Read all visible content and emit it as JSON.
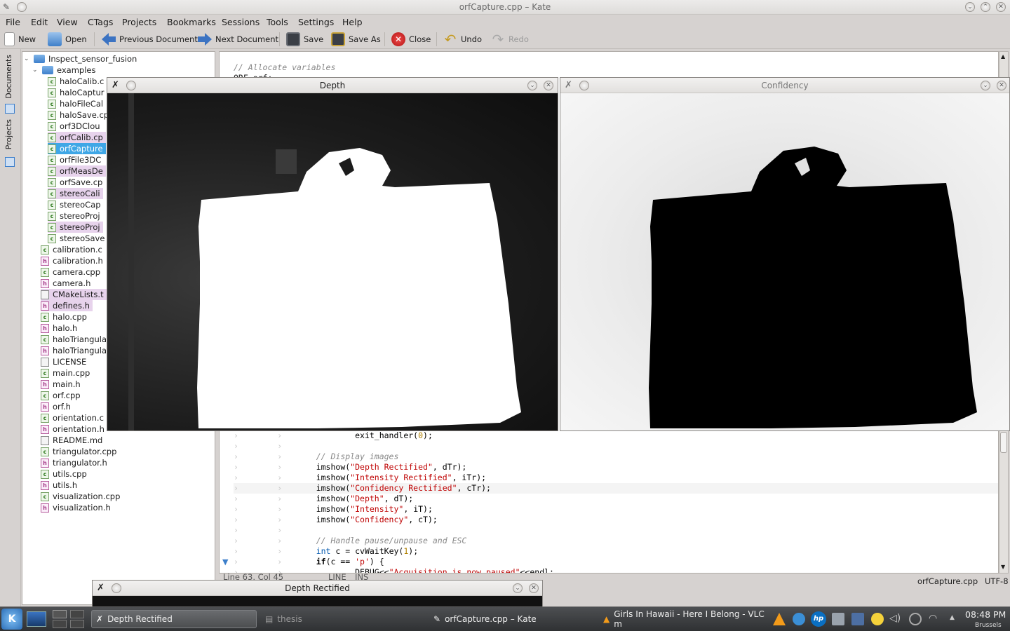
{
  "window": {
    "title": "orfCapture.cpp – Kate"
  },
  "menu": [
    "File",
    "Edit",
    "View",
    "CTags",
    "Projects",
    "Bookmarks",
    "Sessions",
    "Tools",
    "Settings",
    "Help"
  ],
  "toolbar": {
    "new": "New",
    "open": "Open",
    "previous": "Previous Document",
    "next": "Next Document",
    "save": "Save",
    "save_as": "Save As",
    "close": "Close",
    "undo": "Undo",
    "redo": "Redo"
  },
  "sidetabs": {
    "documents": "Documents",
    "projects": "Projects"
  },
  "tree": {
    "root": "Inspect_sensor_fusion",
    "folder": "examples",
    "examples": [
      {
        "name": "haloCalib.c",
        "type": "cpp",
        "state": ""
      },
      {
        "name": "haloCaptur",
        "type": "cpp",
        "state": ""
      },
      {
        "name": "haloFileCal",
        "type": "cpp",
        "state": ""
      },
      {
        "name": "haloSave.cp",
        "type": "cpp",
        "state": ""
      },
      {
        "name": "orf3DClou",
        "type": "cpp",
        "state": ""
      },
      {
        "name": "orfCalib.cp",
        "type": "cpp",
        "state": "hl"
      },
      {
        "name": "orfCapture",
        "type": "cpp",
        "state": "sel"
      },
      {
        "name": "orfFile3DC",
        "type": "cpp",
        "state": ""
      },
      {
        "name": "orfMeasDe",
        "type": "cpp",
        "state": "hl"
      },
      {
        "name": "orfSave.cp",
        "type": "cpp",
        "state": ""
      },
      {
        "name": "stereoCali",
        "type": "cpp",
        "state": "hl"
      },
      {
        "name": "stereoCap",
        "type": "cpp",
        "state": ""
      },
      {
        "name": "stereoProj",
        "type": "cpp",
        "state": ""
      },
      {
        "name": "stereoProj",
        "type": "cpp",
        "state": "hl"
      },
      {
        "name": "stereoSave",
        "type": "cpp",
        "state": ""
      }
    ],
    "files": [
      {
        "name": "calibration.c",
        "type": "cpp",
        "state": ""
      },
      {
        "name": "calibration.h",
        "type": "h",
        "state": ""
      },
      {
        "name": "camera.cpp",
        "type": "cpp",
        "state": ""
      },
      {
        "name": "camera.h",
        "type": "h",
        "state": ""
      },
      {
        "name": "CMakeLists.t",
        "type": "t",
        "state": "hl"
      },
      {
        "name": "defines.h",
        "type": "h",
        "state": "hl"
      },
      {
        "name": "halo.cpp",
        "type": "cpp",
        "state": ""
      },
      {
        "name": "halo.h",
        "type": "h",
        "state": ""
      },
      {
        "name": "haloTriangula",
        "type": "cpp",
        "state": ""
      },
      {
        "name": "haloTriangula",
        "type": "h",
        "state": ""
      },
      {
        "name": "LICENSE",
        "type": "t",
        "state": ""
      },
      {
        "name": "main.cpp",
        "type": "cpp",
        "state": ""
      },
      {
        "name": "main.h",
        "type": "h",
        "state": ""
      },
      {
        "name": "orf.cpp",
        "type": "cpp",
        "state": ""
      },
      {
        "name": "orf.h",
        "type": "h",
        "state": ""
      },
      {
        "name": "orientation.c",
        "type": "cpp",
        "state": ""
      },
      {
        "name": "orientation.h",
        "type": "h",
        "state": ""
      },
      {
        "name": "README.md",
        "type": "t",
        "state": ""
      },
      {
        "name": "triangulator.cpp",
        "type": "cpp",
        "state": ""
      },
      {
        "name": "triangulator.h",
        "type": "h",
        "state": ""
      },
      {
        "name": "utils.cpp",
        "type": "cpp",
        "state": ""
      },
      {
        "name": "utils.h",
        "type": "h",
        "state": ""
      },
      {
        "name": "visualization.cpp",
        "type": "cpp",
        "state": ""
      },
      {
        "name": "visualization.h",
        "type": "h",
        "state": ""
      }
    ]
  },
  "editor": {
    "top_lines": [
      "// Allocate variables",
      "ORF orf;"
    ],
    "lines": [
      {
        "indent": 2,
        "parts": [
          [
            "fn",
            "exit_handler("
          ],
          [
            "num",
            "0"
          ],
          [
            "fn",
            ");"
          ]
        ]
      },
      {
        "indent": 0,
        "parts": []
      },
      {
        "indent": 1,
        "parts": [
          [
            "cmt",
            "// Display images"
          ]
        ]
      },
      {
        "indent": 1,
        "parts": [
          [
            "fn",
            "imshow("
          ],
          [
            "str",
            "\"Depth Rectified\""
          ],
          [
            "fn",
            ", dTr);"
          ]
        ]
      },
      {
        "indent": 1,
        "parts": [
          [
            "fn",
            "imshow("
          ],
          [
            "str",
            "\"Intensity Rectified\""
          ],
          [
            "fn",
            ", iTr);"
          ]
        ]
      },
      {
        "indent": 1,
        "parts": [
          [
            "fn",
            "imshow("
          ],
          [
            "str",
            "\"Confidency Rectified\""
          ],
          [
            "fn",
            ", cTr);"
          ]
        ],
        "current": true
      },
      {
        "indent": 1,
        "parts": [
          [
            "fn",
            "imshow("
          ],
          [
            "str",
            "\"Depth\""
          ],
          [
            "fn",
            ", dT);"
          ]
        ]
      },
      {
        "indent": 1,
        "parts": [
          [
            "fn",
            "imshow("
          ],
          [
            "str",
            "\"Intensity\""
          ],
          [
            "fn",
            ", iT);"
          ]
        ]
      },
      {
        "indent": 1,
        "parts": [
          [
            "fn",
            "imshow("
          ],
          [
            "str",
            "\"Confidency\""
          ],
          [
            "fn",
            ", cT);"
          ]
        ]
      },
      {
        "indent": 0,
        "parts": []
      },
      {
        "indent": 1,
        "parts": [
          [
            "cmt",
            "// Handle pause/unpause and ESC"
          ]
        ]
      },
      {
        "indent": 1,
        "parts": [
          [
            "ty",
            "int"
          ],
          [
            "fn",
            " c = cvWaitKey("
          ],
          [
            "num",
            "1"
          ],
          [
            "fn",
            ");"
          ]
        ]
      },
      {
        "indent": 1,
        "parts": [
          [
            "kw",
            "if"
          ],
          [
            "fn",
            "(c == "
          ],
          [
            "str",
            "'p'"
          ],
          [
            "fn",
            ") {"
          ]
        ]
      },
      {
        "indent": 2,
        "parts": [
          [
            "fn",
            "DEBUG<<"
          ],
          [
            "str",
            "\"Acquisition is now paused\""
          ],
          [
            "fn",
            "<<endl;"
          ]
        ]
      }
    ]
  },
  "status": {
    "position": "Line 63, Col 45",
    "mode": "LINE",
    "insert": "INS",
    "filename": "orfCapture.cpp",
    "encoding": "UTF-8"
  },
  "windows": {
    "depth": "Depth",
    "confidency": "Confidency",
    "depth_rectified": "Depth Rectified"
  },
  "taskbar": {
    "tasks": [
      {
        "label": "Depth Rectified",
        "active": true
      },
      {
        "label": "thesis",
        "active": false
      },
      {
        "label": "orfCapture.cpp – Kate",
        "active": false
      },
      {
        "label": "Girls In Hawaii - Here I Belong - VLC m",
        "active": false
      }
    ],
    "clock": "08:48 PM",
    "location": "Brussels"
  },
  "colors": {
    "selection": "#3fa7e6",
    "highlight": "#e7d3ec",
    "taskbar": "#2f3133"
  }
}
